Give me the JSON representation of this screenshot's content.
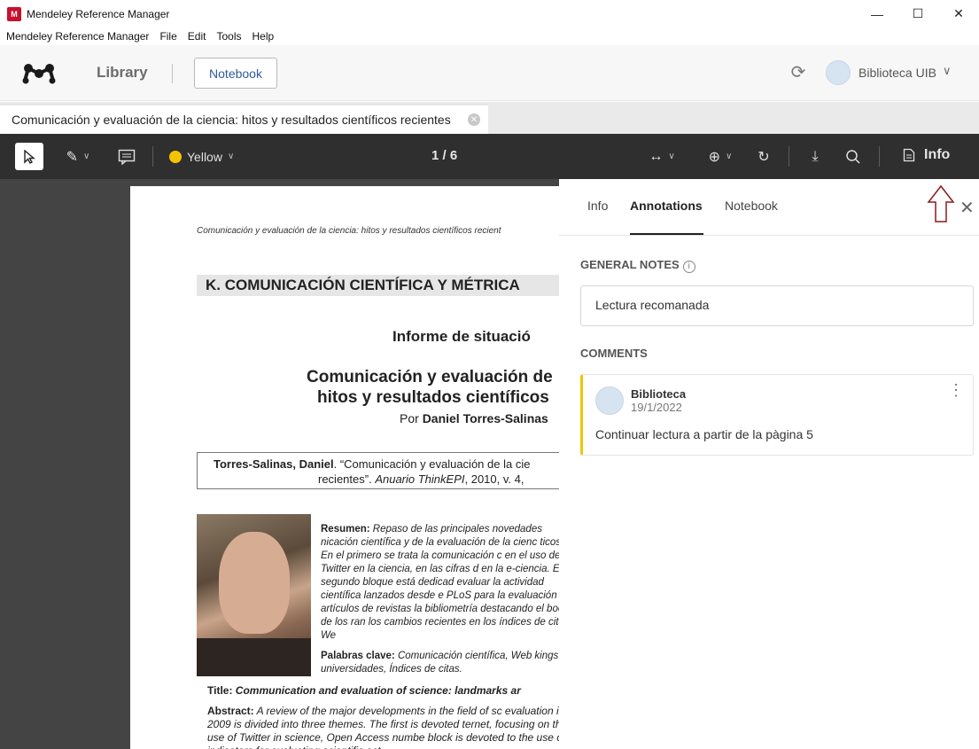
{
  "window": {
    "title": "Mendeley Reference Manager",
    "controls": [
      "—",
      "☐",
      "✕"
    ]
  },
  "menu": [
    "Mendeley Reference Manager",
    "File",
    "Edit",
    "Tools",
    "Help"
  ],
  "header": {
    "library_label": "Library",
    "notebook_button": "Notebook",
    "user_name": "Biblioteca UIB"
  },
  "document_tab": {
    "title": "Comunicación y evaluación de la ciencia: hitos y resultados científicos recientes"
  },
  "pdf_toolbar": {
    "highlight_color": "Yellow",
    "page_indicator": "1 / 6",
    "info_label": "Info"
  },
  "pdf_page": {
    "running_head": "Comunicación y evaluación de la ciencia: hitos y resultados científicos recient",
    "section_heading": "K. COMUNICACIÓN CIENTÍFICA Y MÉTRICA",
    "report_heading": "Informe de situació",
    "title_line1": "Comunicación y evaluación de",
    "title_line2": "hitos y resultados científicos",
    "byline_prefix": "Por ",
    "byline_author": "Daniel Torres-Salinas",
    "citation_author": "Torres-Salinas, Daniel",
    "citation_rest": ". “Comunicación y evaluación de la cie",
    "citation_line2_a": "recientes”. ",
    "citation_line2_journal": "Anuario ThinkEPI",
    "citation_line2_b": ", 2010, v. 4,",
    "abstract_label": "Resumen:",
    "abstract_text": " Repaso de las principales novedades nicación científica y de la evaluación de la cienc ticos. En el primero se trata la comunicación c en el uso de Twitter en la ciencia, en las cifras d en la e-ciencia. El segundo bloque está dedicad evaluar la actividad científica lanzados desde e PLoS para la evaluación de artículos de revistas la bibliometría destacando el boom de los ran los cambios recientes en los índices de citas We",
    "keywords_label": "Palabras clave:",
    "keywords_text": " Comunicación científica, Web kings de universidades, Índices de citas.",
    "title_en_label": "Title:",
    "title_en_text": " Communication and evaluation of science: landmarks ar",
    "abstract_en_label": "Abstract:",
    "abstract_en_text": " A review of the major developments in the field of sc evaluation in 2009 is divided into three themes. The first is devoted ternet, focusing on the use of Twitter in science, Open Access numbe block is devoted to the use of indicators for evaluating scientific act"
  },
  "panel": {
    "tabs": [
      "Info",
      "Annotations",
      "Notebook"
    ],
    "active_tab": "Annotations",
    "general_notes_label": "GENERAL NOTES",
    "general_notes_value": "Lectura recomanada",
    "comments_label": "COMMENTS",
    "comment": {
      "author": "Biblioteca",
      "date": "19/1/2022",
      "text": "Continuar lectura a partir de la pàgina 5"
    }
  },
  "colors": {
    "accent_yellow": "#f2c500",
    "toolbar_bg": "#2f2f2f",
    "arrow_outline": "#8b1a1a"
  }
}
